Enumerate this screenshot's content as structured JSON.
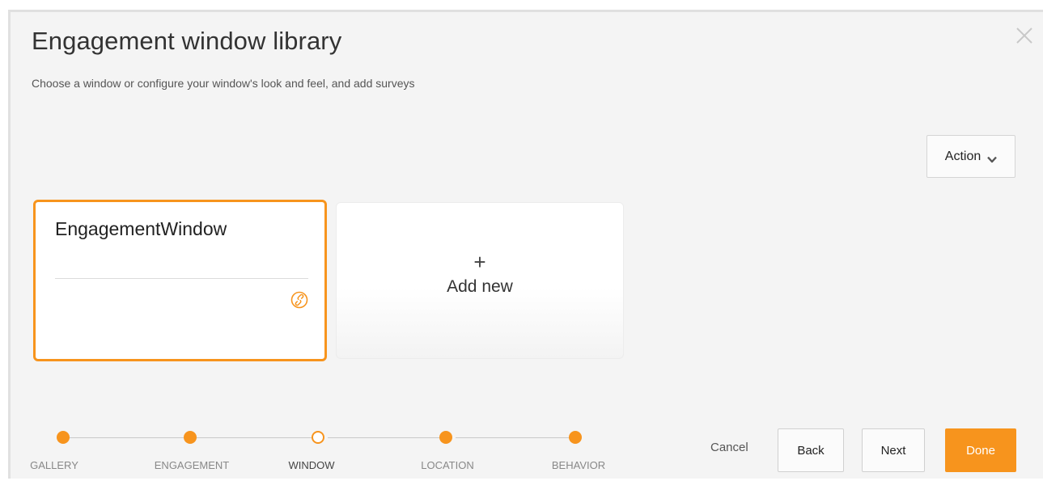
{
  "dialog": {
    "title": "Engagement window library",
    "subtitle": "Choose a window or configure your window's look and feel, and add surveys",
    "close_icon": "close-icon"
  },
  "toolbar": {
    "action_label": "Action",
    "action_icon": "chevron-down-icon"
  },
  "cards": {
    "selected": {
      "name": "EngagementWindow",
      "link_icon": "link-icon"
    },
    "add_new": {
      "plus": "+",
      "label": "Add new"
    }
  },
  "stepper": {
    "steps": [
      {
        "label": "GALLERY",
        "state": "done"
      },
      {
        "label": "ENGAGEMENT",
        "state": "done"
      },
      {
        "label": "WINDOW",
        "state": "current"
      },
      {
        "label": "LOCATION",
        "state": "done"
      },
      {
        "label": "BEHAVIOR",
        "state": "done"
      }
    ]
  },
  "footer": {
    "cancel_label": "Cancel",
    "back_label": "Back",
    "next_label": "Next",
    "done_label": "Done"
  },
  "colors": {
    "accent": "#f7941d",
    "background": "#f4f4f4",
    "card_border_selected": "#f7941d"
  }
}
